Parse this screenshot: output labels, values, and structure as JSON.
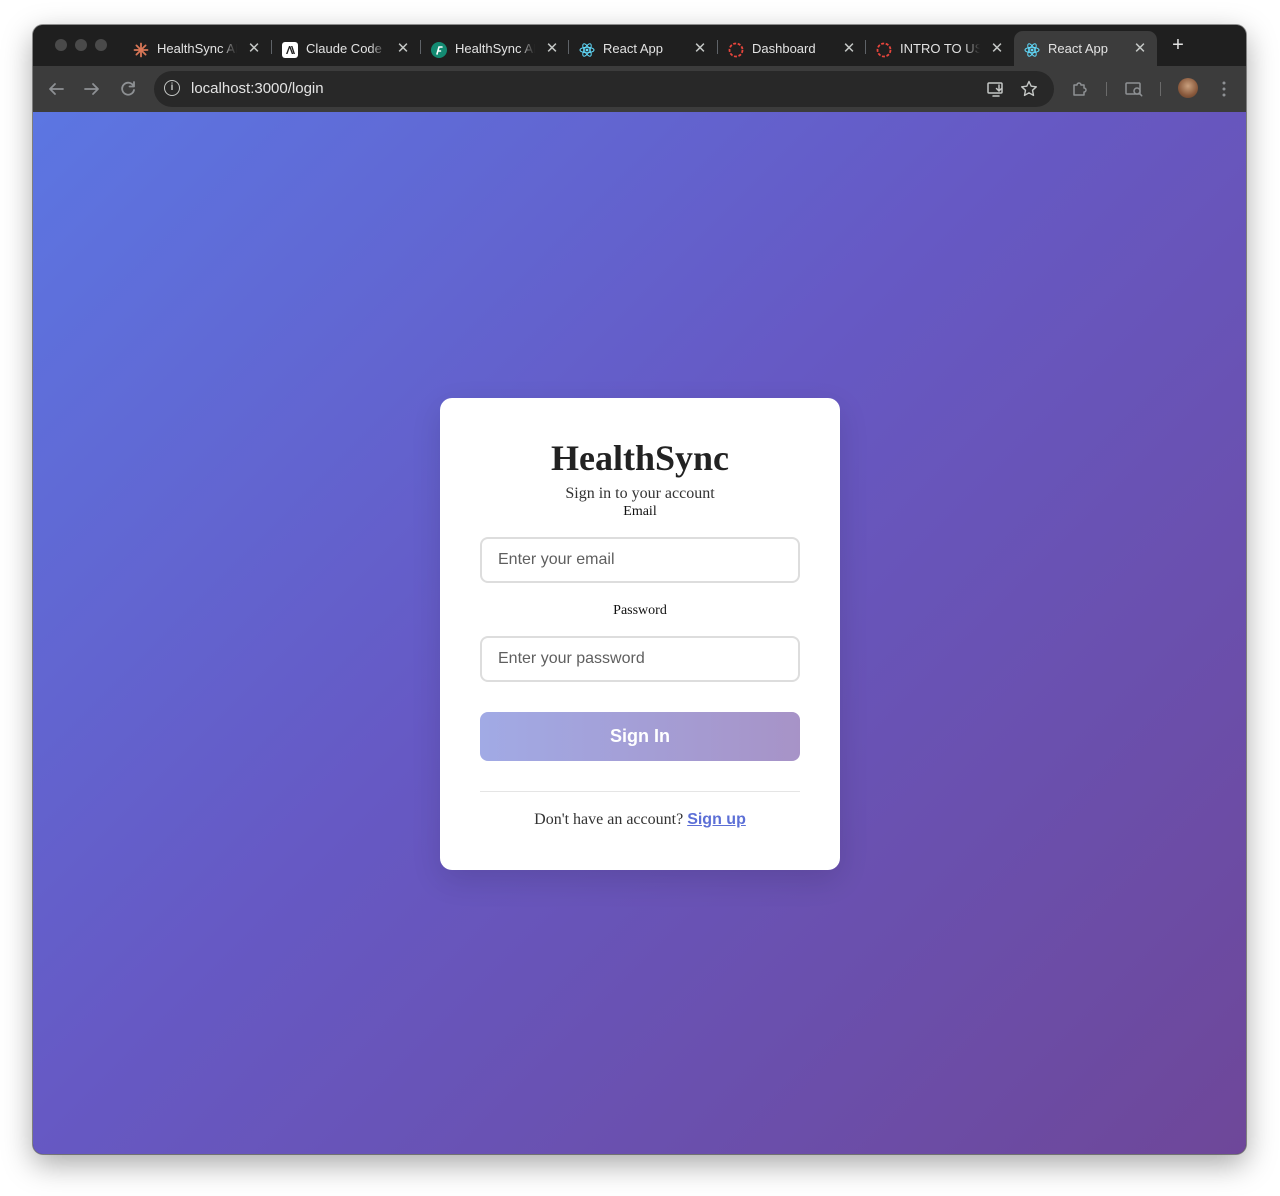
{
  "browser": {
    "tabs": [
      {
        "title": "HealthSync AI",
        "icon": "claude-starburst-icon",
        "active": false
      },
      {
        "title": "Claude Code",
        "icon": "anthropic-icon",
        "active": false
      },
      {
        "title": "HealthSync AI",
        "icon": "teal-f-icon",
        "active": false
      },
      {
        "title": "React App",
        "icon": "react-icon",
        "active": false
      },
      {
        "title": "Dashboard",
        "icon": "red-dashed-circle-icon",
        "active": false
      },
      {
        "title": "INTRO TO US",
        "icon": "red-dashed-circle-icon",
        "active": false
      },
      {
        "title": "React App",
        "icon": "react-icon",
        "active": true
      }
    ],
    "close_glyph": "✕",
    "new_tab_glyph": "+",
    "url": "localhost:3000/login"
  },
  "login": {
    "title": "HealthSync",
    "subtitle": "Sign in to your account",
    "email_label": "Email",
    "email_placeholder": "Enter your email",
    "password_label": "Password",
    "password_placeholder": "Enter your password",
    "submit_label": "Sign In",
    "signup_prompt": "Don't have an account?",
    "signup_link": "Sign up"
  },
  "colors": {
    "background_gradient_start": "#5c76e2",
    "background_gradient_end": "#6e4799",
    "button_gradient_start": "#a1aae5",
    "button_gradient_end": "#a793c7",
    "link": "#5c6fd6"
  }
}
